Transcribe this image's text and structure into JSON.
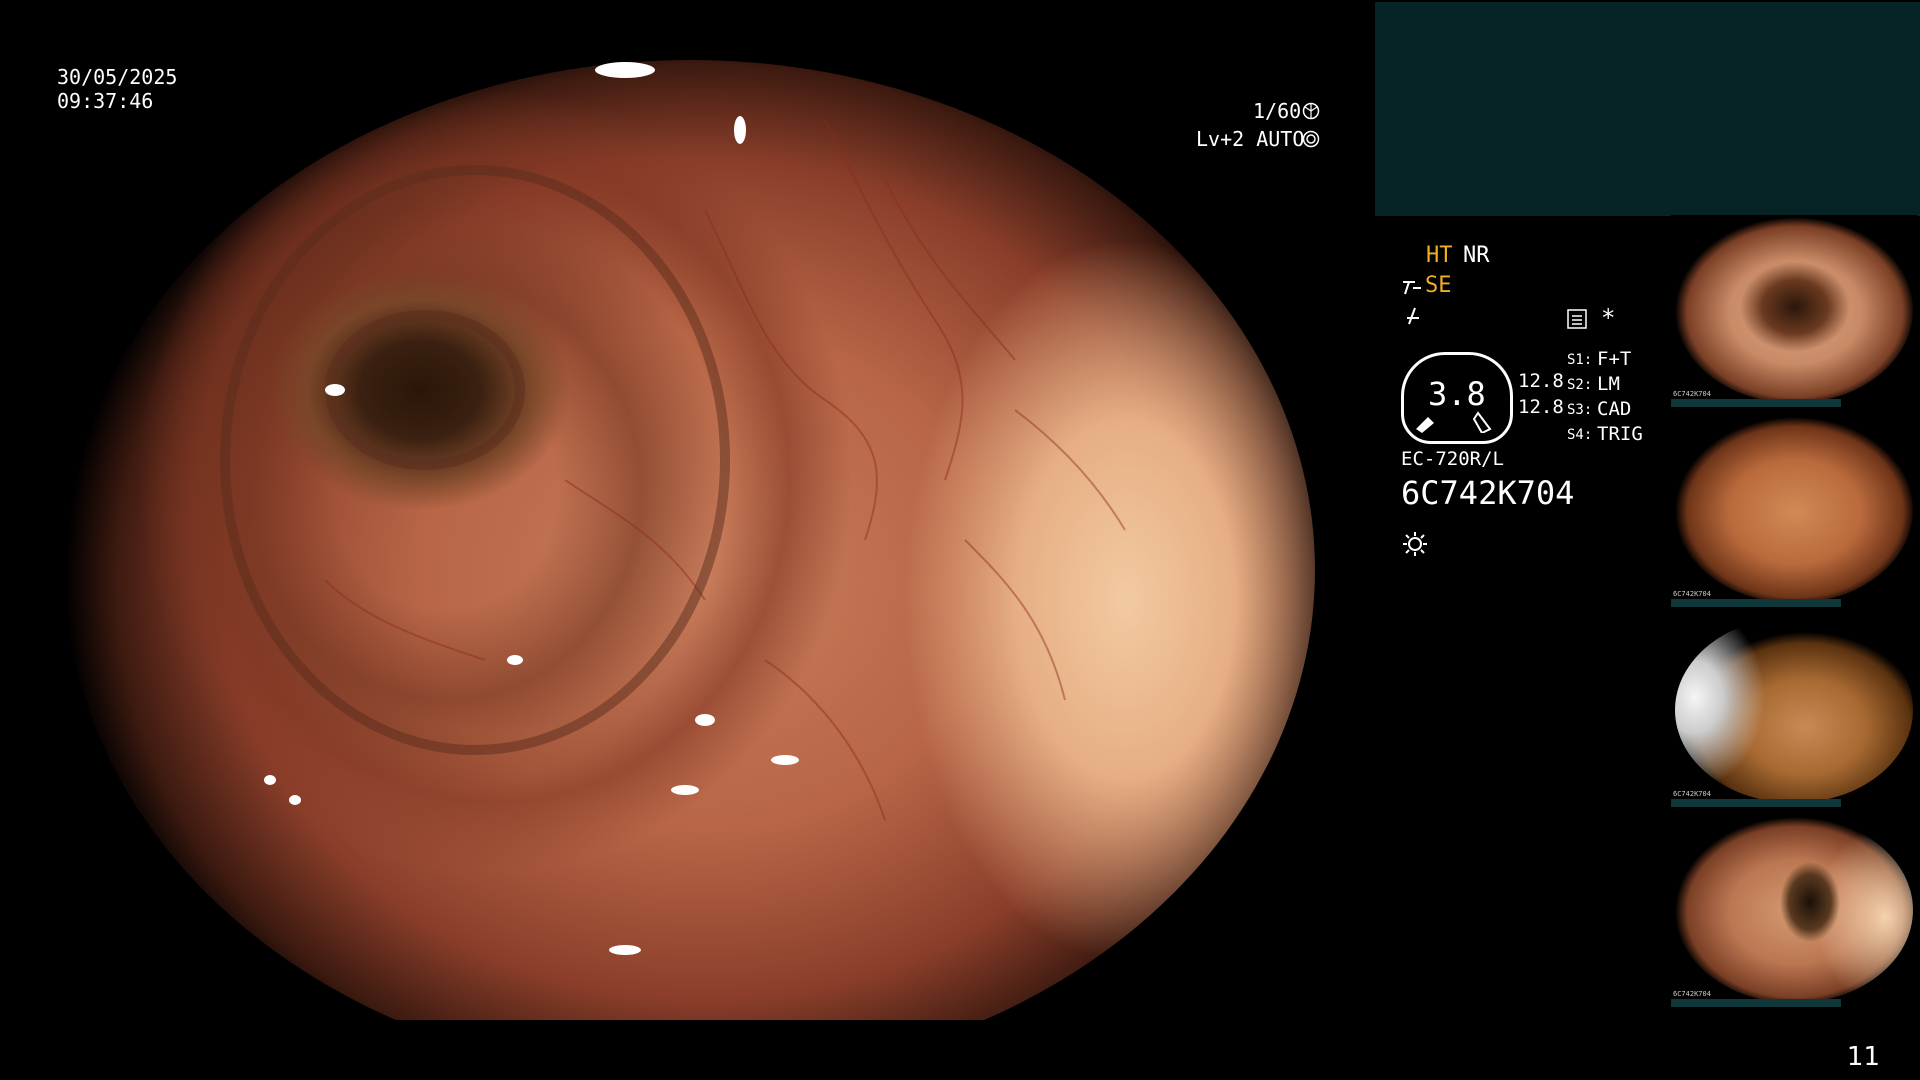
{
  "overlay": {
    "date": "30/05/2025",
    "time": "09:37:46",
    "shutter": "1/60",
    "brightness": "Lv+2 AUTO"
  },
  "panel": {
    "ht": "HT",
    "nr": "NR",
    "se": "SE",
    "gauge_value": "3.8",
    "value_top": "12.8",
    "value_bottom": "12.8",
    "switches": [
      {
        "key": "S1:",
        "value": "F+T"
      },
      {
        "key": "S2:",
        "value": "LM"
      },
      {
        "key": "S3:",
        "value": "CAD"
      },
      {
        "key": "S4:",
        "value": "TRIG"
      }
    ],
    "model": "EC-720R/L",
    "serial": "6C742K704",
    "asterisk": "*"
  },
  "thumbnails": [
    {
      "caption": "6C742K704"
    },
    {
      "caption": "6C742K704"
    },
    {
      "caption": "6C742K704"
    },
    {
      "caption": "6C742K704"
    }
  ],
  "page_number": "11",
  "icons": {
    "shutter": "aperture-icon",
    "auto": "auto-iris-icon",
    "se": "structure-enhance-icon",
    "color": "color-mode-icon",
    "record": "record-icon",
    "light": "light-source-icon"
  },
  "colors": {
    "accent_yellow": "#f0b020",
    "panel_teal": "#062426"
  }
}
